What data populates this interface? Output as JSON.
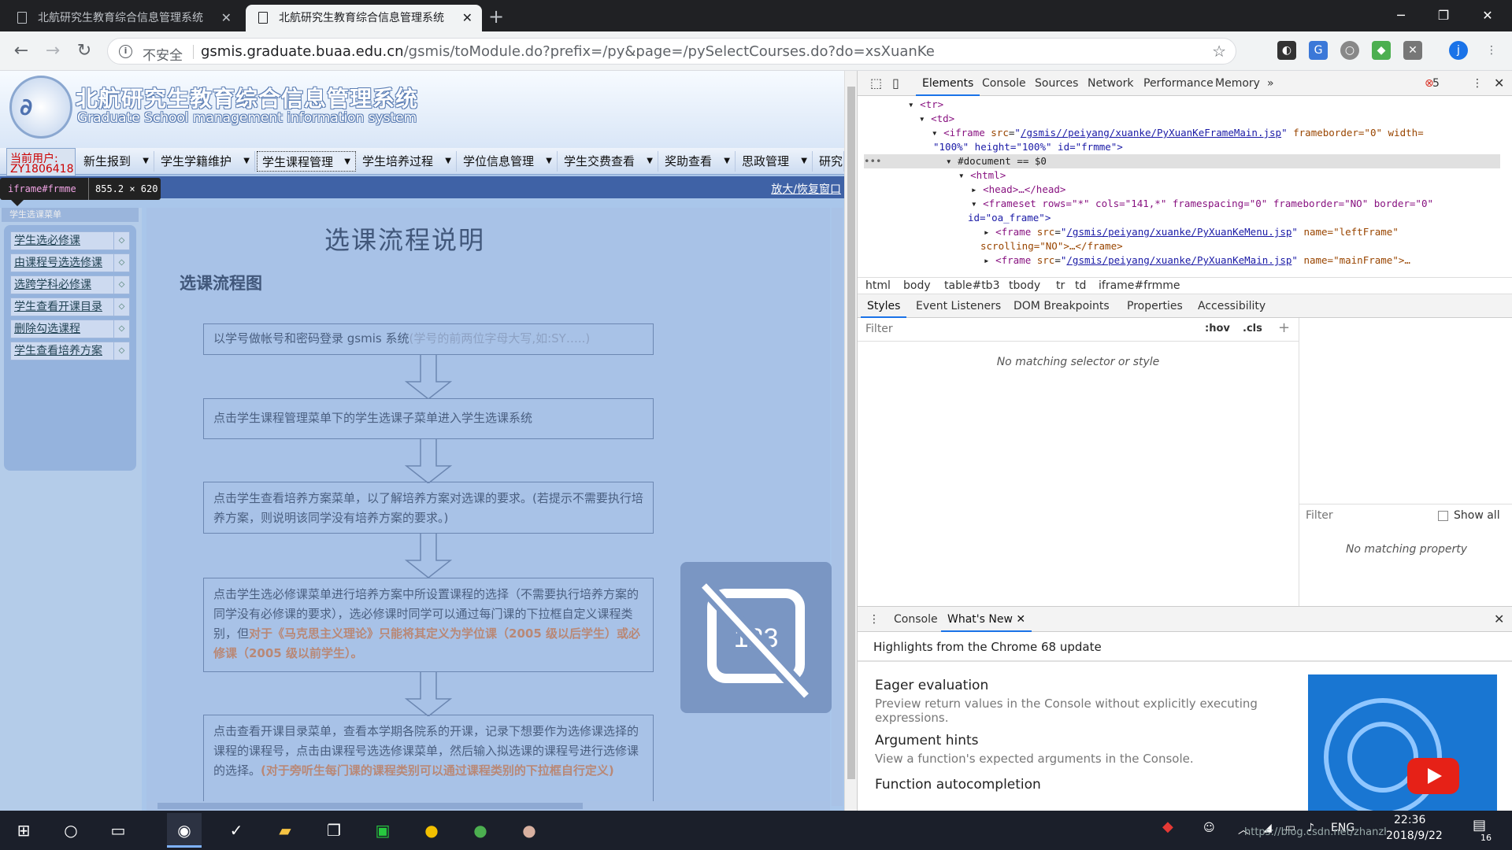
{
  "browser": {
    "tabs": [
      {
        "title": "北航研究生教育综合信息管理系统",
        "active": false
      },
      {
        "title": "北航研究生教育综合信息管理系统",
        "active": true
      }
    ],
    "new_tab": "+",
    "window": {
      "minimize": "─",
      "maximize": "❐",
      "close": "✕"
    },
    "insecure_label": "不安全",
    "url_host": "gsmis.graduate.buaa.edu.cn",
    "url_path": "/gsmis/toModule.do?prefix=/py&page=/pySelectCourses.do?do=xsXuanKe",
    "profile_initial": "j"
  },
  "page": {
    "system_title": "北航研究生教育综合信息管理系统",
    "system_subtitle": "Graduate School management information system",
    "user_label": "当前用户:",
    "user_id": "ZY1806418",
    "menu": [
      "新生报到",
      "学生学籍维护",
      "学生课程管理",
      "学生培养过程",
      "学位信息管理",
      "学生交费查看",
      "奖助查看",
      "思政管理",
      "研究"
    ],
    "selected_menu": "学生课程管理",
    "zoom_link": "放大/恢复窗口",
    "inspect_tip_selector": "iframe#frmme",
    "inspect_tip_size": "855.2 × 620",
    "left_header": "学生选课菜单",
    "left_items": [
      "学生选必修课",
      "由课程号选选修课",
      "选跨学科必修课",
      "学生查看开课目录",
      "删除勾选课程",
      "学生查看培养方案"
    ],
    "content_title": "选课流程说明",
    "content_subtitle": "选课流程图",
    "steps": [
      {
        "text": "以学号做帐号和密码登录 gsmis 系统",
        "note": "(学号的前两位字母大写,如:SY…..)"
      },
      {
        "text": "点击学生课程管理菜单下的学生选课子菜单进入学生选课系统"
      },
      {
        "text": "点击学生查看培养方案菜单，以了解培养方案对选课的要求。(若提示不需要执行培养方案，则说明该同学没有培养方案的要求。)"
      },
      {
        "text": "点击学生选必修课菜单进行培养方案中所设置课程的选择（不需要执行培养方案的同学没有必修课的要求），选必修课时同学可以通过每门课的下拉框自定义课程类别，但",
        "highlight": "对于《马克思主义理论》只能将其定义为学位课（2005 级以后学生）或必修课（2005 级以前学生）。"
      },
      {
        "text": "点击查看开课目录菜单，查看本学期各院系的开课，记录下想要作为选修课选择的课程的课程号，点击由课程号选选修课菜单，然后输入拟选课的课程号进行选修课的选择。",
        "highlight": "(对于旁听生每门课的课程类别可以通过课程类别的下拉框自行定义)"
      }
    ],
    "overlay_text": "123"
  },
  "devtools": {
    "tabs": [
      "Elements",
      "Console",
      "Sources",
      "Network",
      "Performance",
      "Memory"
    ],
    "active_tab": "Elements",
    "more_tabs": "»",
    "error_count": "5",
    "tree": {
      "tr": "<tr>",
      "td": "<td>",
      "iframe_src": "/gsmis//peiyang/xuanke/PyXuanKeFrameMain.jsp",
      "iframe_rest": "frameborder=\"0\" width=",
      "iframe_rest2": "\"100%\" height=\"100%\" id=\"frmme\">",
      "document": "#document == $0",
      "html": "<html>",
      "head": "<head>…</head>",
      "frameset": "<frameset rows=\"*\" cols=\"141,*\" framespacing=\"0\" frameborder=\"NO\" border=\"0\"",
      "frameset2": "id=\"oa_frame\">",
      "frame1_src": "/gsmis/peiyang/xuanke/PyXuanKeMenu.jsp",
      "frame1_name": "name=\"leftFrame\"",
      "frame1_tail": "scrolling=\"NO\">…</frame>",
      "frame2_src": "/gsmis/peiyang/xuanke/PyXuanKeMain.jsp",
      "frame2_name": "name=\"mainFrame\">…"
    },
    "breadcrumb": [
      "html",
      "body",
      "table#tb3",
      "tbody",
      "tr",
      "td",
      "iframe#frmme"
    ],
    "subtabs": [
      "Styles",
      "Event Listeners",
      "DOM Breakpoints",
      "Properties",
      "Accessibility"
    ],
    "active_subtab": "Styles",
    "filter_placeholder": "Filter",
    "hov": ":hov",
    "cls": ".cls",
    "no_selector": "No matching selector or style",
    "computed_filter": "Filter",
    "show_all": "Show all",
    "no_property": "No matching property",
    "drawer_tabs": [
      "Console",
      "What's New"
    ],
    "drawer_active": "What's New",
    "highlights": "Highlights from the Chrome 68 update",
    "features": [
      {
        "title": "Eager evaluation",
        "desc": "Preview return values in the Console without explicitly executing expressions."
      },
      {
        "title": "Argument hints",
        "desc": "View a function's expected arguments in the Console."
      },
      {
        "title": "Function autocompletion",
        "desc": ""
      }
    ]
  },
  "taskbar": {
    "lang": "ENG",
    "time": "22:36",
    "date": "2018/9/22",
    "notification_count": "16",
    "watermark": "https://blog.csdn.net/zhanzhi..."
  }
}
